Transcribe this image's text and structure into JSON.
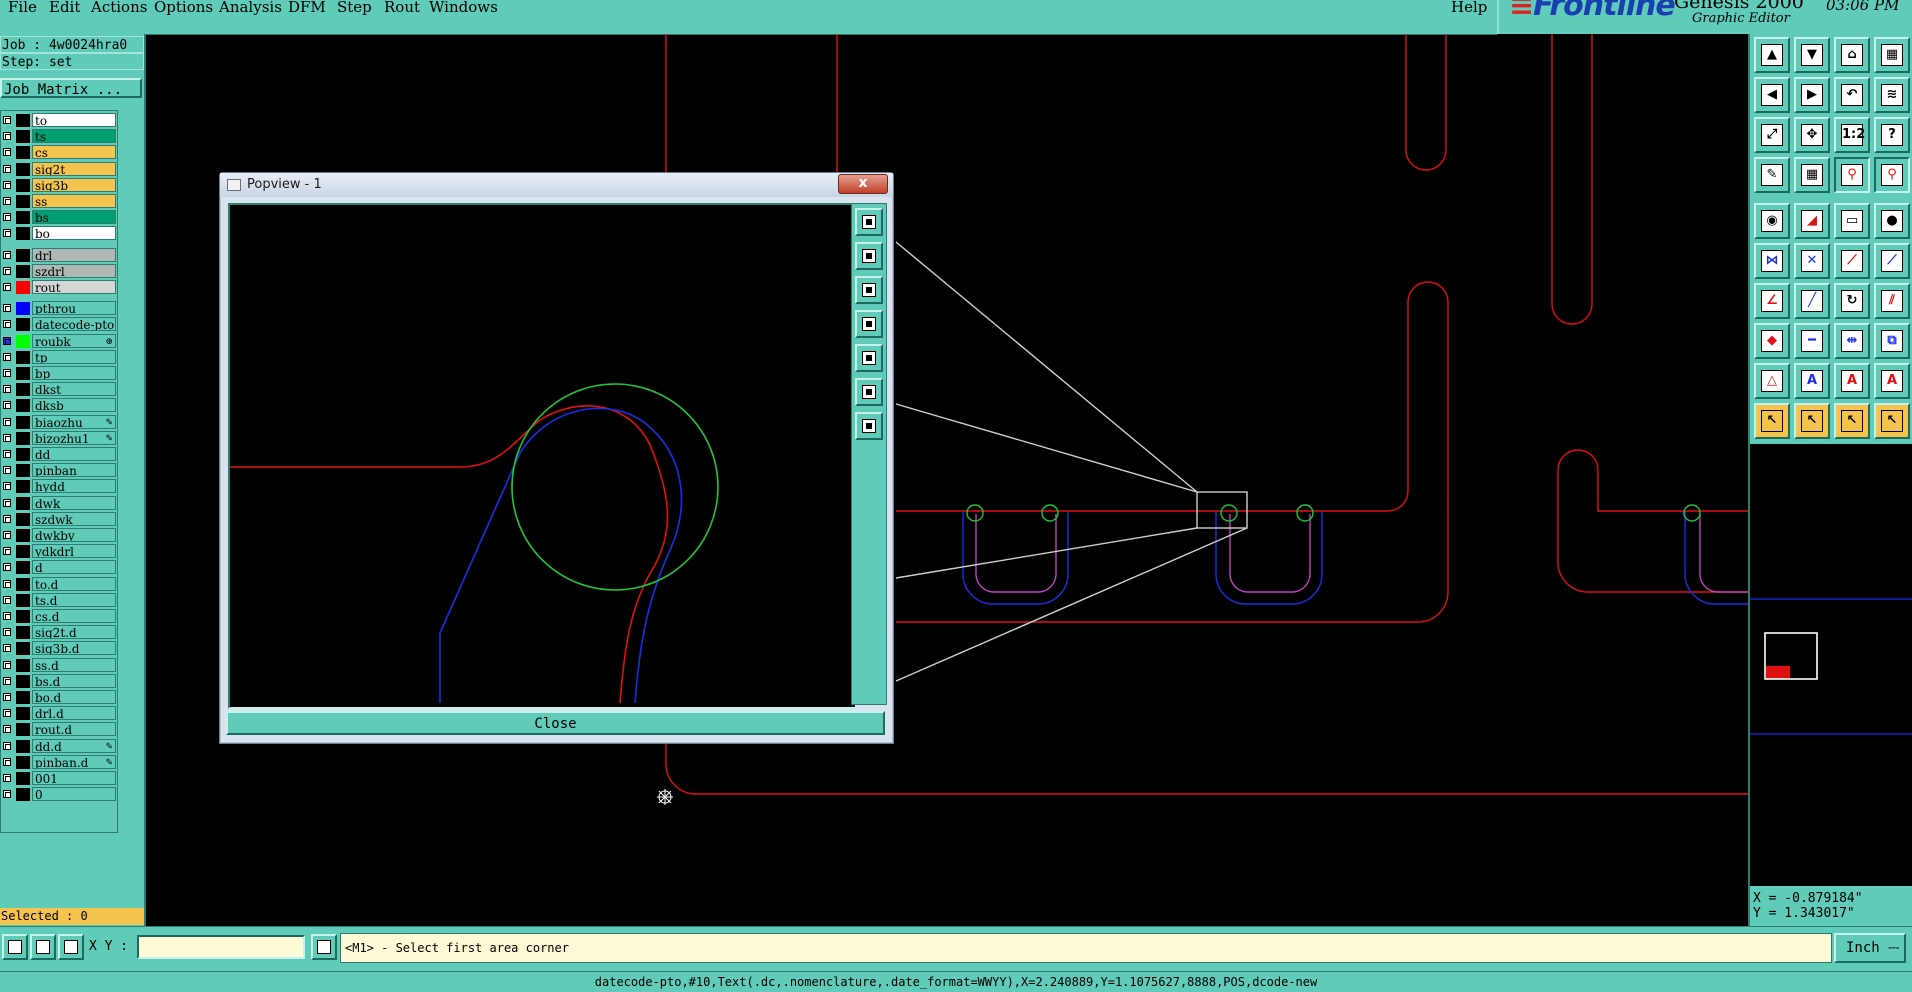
{
  "menu": [
    "File",
    "Edit",
    "Actions",
    "Options",
    "Analysis",
    "DFM",
    "Step",
    "Rout",
    "Windows"
  ],
  "help_label": "Help",
  "brand": {
    "logo": "Frontline",
    "product": "Genesis 2000",
    "subtitle": "Graphic Editor",
    "time": "03:06 PM"
  },
  "job": {
    "job_line": "Job : 4w0024hra0",
    "step_line": "Step: set",
    "matrix_button": "Job Matrix ..."
  },
  "layers": [
    {
      "name": "to",
      "name_bg": "#ffffff",
      "swatch": "#000000"
    },
    {
      "name": "ts",
      "name_bg": "#009f72",
      "swatch": "#000000"
    },
    {
      "name": "cs",
      "name_bg": "#f5c44e",
      "swatch": "#000000"
    },
    {
      "name": "sig2t",
      "name_bg": "#f5c44e",
      "swatch": "#000000"
    },
    {
      "name": "sig3b",
      "name_bg": "#f5c44e",
      "swatch": "#000000"
    },
    {
      "name": "ss",
      "name_bg": "#f5c44e",
      "swatch": "#000000"
    },
    {
      "name": "bs",
      "name_bg": "#009f72",
      "swatch": "#000000"
    },
    {
      "name": "bo",
      "name_bg": "#ffffff",
      "swatch": "#000000"
    },
    {
      "name": "drl",
      "name_bg": "#b0b8b6",
      "swatch": "#000000",
      "gap_before": true
    },
    {
      "name": "szdrl",
      "name_bg": "#b0b8b6",
      "swatch": "#000000"
    },
    {
      "name": "rout",
      "name_bg": "#d6d6d6",
      "swatch": "#ff0000"
    },
    {
      "name": "pthrou",
      "name_bg": "#5fcbb8",
      "swatch": "#0000ff",
      "gap_before": true
    },
    {
      "name": "datecode-pto",
      "name_bg": "#5fcbb8",
      "swatch": "#000000"
    },
    {
      "name": "roubk",
      "name_bg": "#5fcbb8",
      "swatch": "#00ff00",
      "flag": "⊛",
      "check_on": true
    },
    {
      "name": "tp",
      "name_bg": "#5fcbb8",
      "swatch": "#000000"
    },
    {
      "name": "bp",
      "name_bg": "#5fcbb8",
      "swatch": "#000000"
    },
    {
      "name": "dkst",
      "name_bg": "#5fcbb8",
      "swatch": "#000000"
    },
    {
      "name": "dksb",
      "name_bg": "#5fcbb8",
      "swatch": "#000000"
    },
    {
      "name": "biaozhu",
      "name_bg": "#5fcbb8",
      "swatch": "#000000",
      "flag": "✎"
    },
    {
      "name": "bizozhu1",
      "name_bg": "#5fcbb8",
      "swatch": "#000000",
      "flag": "✎"
    },
    {
      "name": "dd",
      "name_bg": "#5fcbb8",
      "swatch": "#000000"
    },
    {
      "name": "pinban",
      "name_bg": "#5fcbb8",
      "swatch": "#000000"
    },
    {
      "name": "hydd",
      "name_bg": "#5fcbb8",
      "swatch": "#000000"
    },
    {
      "name": "dwk",
      "name_bg": "#5fcbb8",
      "swatch": "#000000"
    },
    {
      "name": "szdwk",
      "name_bg": "#5fcbb8",
      "swatch": "#000000"
    },
    {
      "name": "dwkby",
      "name_bg": "#5fcbb8",
      "swatch": "#000000"
    },
    {
      "name": "ydkdrl",
      "name_bg": "#5fcbb8",
      "swatch": "#000000"
    },
    {
      "name": "d",
      "name_bg": "#5fcbb8",
      "swatch": "#000000"
    },
    {
      "name": "to.d",
      "name_bg": "#5fcbb8",
      "swatch": "#000000"
    },
    {
      "name": "ts.d",
      "name_bg": "#5fcbb8",
      "swatch": "#000000"
    },
    {
      "name": "cs.d",
      "name_bg": "#5fcbb8",
      "swatch": "#000000"
    },
    {
      "name": "sig2t.d",
      "name_bg": "#5fcbb8",
      "swatch": "#000000"
    },
    {
      "name": "sig3b.d",
      "name_bg": "#5fcbb8",
      "swatch": "#000000"
    },
    {
      "name": "ss.d",
      "name_bg": "#5fcbb8",
      "swatch": "#000000"
    },
    {
      "name": "bs.d",
      "name_bg": "#5fcbb8",
      "swatch": "#000000"
    },
    {
      "name": "bo.d",
      "name_bg": "#5fcbb8",
      "swatch": "#000000"
    },
    {
      "name": "drl.d",
      "name_bg": "#5fcbb8",
      "swatch": "#000000"
    },
    {
      "name": "rout.d",
      "name_bg": "#5fcbb8",
      "swatch": "#000000"
    },
    {
      "name": "dd.d",
      "name_bg": "#5fcbb8",
      "swatch": "#000000",
      "flag": "✎"
    },
    {
      "name": "pinban.d",
      "name_bg": "#5fcbb8",
      "swatch": "#000000",
      "flag": "✎"
    },
    {
      "name": "001",
      "name_bg": "#5fcbb8",
      "swatch": "#000000"
    },
    {
      "name": "0",
      "name_bg": "#5fcbb8",
      "swatch": "#000000"
    }
  ],
  "selected_label": "Selected : 0",
  "popview": {
    "title": "Popview - 1",
    "close_label": "Close",
    "close_x": "x"
  },
  "coords": {
    "x": "X = -0.879184\"",
    "y": "Y = 1.343017\""
  },
  "xy_label": "X Y :",
  "xy_input_value": "",
  "prompt": "<M1> - Select first area corner",
  "units": "Inch",
  "status_line": "datecode-pto,#10,Text(.dc,.nomenclature,.date_format=WWYY),X=2.240889,Y=1.1075627,8888,POS,dcode-new",
  "toolbox": [
    {
      "icon": "open-step-icon"
    },
    {
      "icon": "save-icon"
    },
    {
      "icon": "home-icon"
    },
    {
      "icon": "layout-icon"
    },
    {
      "icon": "zoom-prev-icon"
    },
    {
      "icon": "zoom-next-icon"
    },
    {
      "icon": "undo-view-icon"
    },
    {
      "icon": "snap-icon"
    },
    {
      "icon": "fit-icon"
    },
    {
      "icon": "center-icon"
    },
    {
      "icon": "scale-1-2-icon"
    },
    {
      "icon": "help-icon"
    },
    {
      "icon": "measure-icon"
    },
    {
      "icon": "grid-icon"
    },
    {
      "icon": "net-icon"
    },
    {
      "icon": "net-alt-icon"
    },
    {
      "icon": "pad-icon"
    },
    {
      "icon": "line-icon"
    },
    {
      "icon": "ruler-icon"
    },
    {
      "icon": "circle-fill-icon"
    },
    {
      "icon": "connect-icon"
    },
    {
      "icon": "cross-icon"
    },
    {
      "icon": "segment-icon"
    },
    {
      "icon": "segment-alt-icon"
    },
    {
      "icon": "angle-icon"
    },
    {
      "icon": "slash-icon"
    },
    {
      "icon": "arc-icon"
    },
    {
      "icon": "split-icon"
    },
    {
      "icon": "pad-move-icon"
    },
    {
      "icon": "dash-icon"
    },
    {
      "icon": "align-icon"
    },
    {
      "icon": "pad-group-icon"
    },
    {
      "icon": "triangle-icon"
    },
    {
      "icon": "triangle-a-icon"
    },
    {
      "icon": "triangle-b-icon"
    },
    {
      "icon": "triangle-c-icon"
    },
    {
      "icon": "pointer-icon"
    },
    {
      "icon": "pointer-select-icon"
    },
    {
      "icon": "pointer-area-icon"
    },
    {
      "icon": "pointer-net-icon"
    }
  ],
  "colors": {
    "panel": "#5fcbb8",
    "rout": "#e01010",
    "outline": "#1a2ee8",
    "drill": "#22c43a",
    "magenta": "#c040c0",
    "highlight": "#f5c44e"
  }
}
